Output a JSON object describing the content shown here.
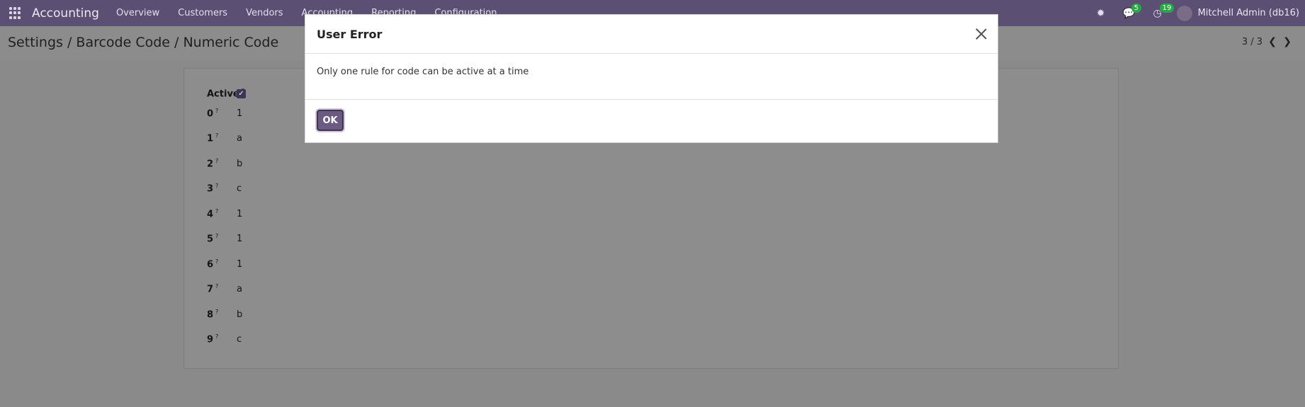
{
  "navbar": {
    "app_name": "Accounting",
    "menu": [
      "Overview",
      "Customers",
      "Vendors",
      "Accounting",
      "Reporting",
      "Configuration"
    ],
    "messages_count": "5",
    "activities_count": "19",
    "user": "Mitchell Admin (db16)"
  },
  "breadcrumb": "Settings / Barcode Code / Numeric Code",
  "pager": "3 / 3",
  "form": {
    "active_label": "Active",
    "rows": [
      {
        "label": "0",
        "value": "1"
      },
      {
        "label": "1",
        "value": "a"
      },
      {
        "label": "2",
        "value": "b"
      },
      {
        "label": "3",
        "value": "c"
      },
      {
        "label": "4",
        "value": "1"
      },
      {
        "label": "5",
        "value": "1"
      },
      {
        "label": "6",
        "value": "1"
      },
      {
        "label": "7",
        "value": "a"
      },
      {
        "label": "8",
        "value": "b"
      },
      {
        "label": "9",
        "value": "c"
      }
    ]
  },
  "modal": {
    "title": "User Error",
    "message": "Only one rule for code can be active at a time",
    "ok_label": "OK"
  }
}
